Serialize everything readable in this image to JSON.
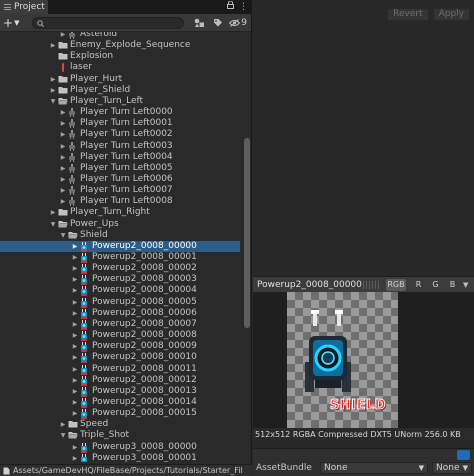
{
  "project_panel": {
    "tab_label": "Project",
    "search": {
      "value": "",
      "placeholder": ""
    },
    "hidden_count": "9",
    "tree": [
      {
        "label": "Asteroid",
        "type": "frame",
        "depth": 4,
        "arrow": "collapsed"
      },
      {
        "label": "Enemy_Explode_Sequence",
        "type": "folder",
        "depth": 3,
        "arrow": "collapsed"
      },
      {
        "label": "Explosion",
        "type": "folder",
        "depth": 3,
        "arrow": "none"
      },
      {
        "label": "laser",
        "type": "laser",
        "depth": 3,
        "arrow": "none"
      },
      {
        "label": "Player_Hurt",
        "type": "folder",
        "depth": 3,
        "arrow": "collapsed"
      },
      {
        "label": "Player_Shield",
        "type": "folder",
        "depth": 3,
        "arrow": "collapsed"
      },
      {
        "label": "Player_Turn_Left",
        "type": "folder",
        "depth": 3,
        "arrow": "expanded"
      },
      {
        "label": "Player Turn Left0000",
        "type": "frame",
        "depth": 4,
        "arrow": "collapsed"
      },
      {
        "label": "Player Turn Left0001",
        "type": "frame",
        "depth": 4,
        "arrow": "collapsed"
      },
      {
        "label": "Player Turn Left0002",
        "type": "frame",
        "depth": 4,
        "arrow": "collapsed"
      },
      {
        "label": "Player Turn Left0003",
        "type": "frame",
        "depth": 4,
        "arrow": "collapsed"
      },
      {
        "label": "Player Turn Left0004",
        "type": "frame",
        "depth": 4,
        "arrow": "collapsed"
      },
      {
        "label": "Player Turn Left0005",
        "type": "frame",
        "depth": 4,
        "arrow": "collapsed"
      },
      {
        "label": "Player Turn Left0006",
        "type": "frame",
        "depth": 4,
        "arrow": "collapsed"
      },
      {
        "label": "Player Turn Left0007",
        "type": "frame",
        "depth": 4,
        "arrow": "collapsed"
      },
      {
        "label": "Player Turn Left0008",
        "type": "frame",
        "depth": 4,
        "arrow": "collapsed"
      },
      {
        "label": "Player_Turn_Right",
        "type": "folder",
        "depth": 3,
        "arrow": "collapsed"
      },
      {
        "label": "Power_Ups",
        "type": "folder",
        "depth": 3,
        "arrow": "expanded"
      },
      {
        "label": "Shield",
        "type": "folder",
        "depth": 4,
        "arrow": "expanded"
      },
      {
        "label": "Powerup2_0008_00000",
        "type": "powerup",
        "depth": 5,
        "arrow": "collapsed",
        "selected": true
      },
      {
        "label": "Powerup2_0008_00001",
        "type": "powerup",
        "depth": 5,
        "arrow": "collapsed"
      },
      {
        "label": "Powerup2_0008_00002",
        "type": "powerup",
        "depth": 5,
        "arrow": "collapsed"
      },
      {
        "label": "Powerup2_0008_00003",
        "type": "powerup",
        "depth": 5,
        "arrow": "collapsed"
      },
      {
        "label": "Powerup2_0008_00004",
        "type": "powerup",
        "depth": 5,
        "arrow": "collapsed"
      },
      {
        "label": "Powerup2_0008_00005",
        "type": "powerup",
        "depth": 5,
        "arrow": "collapsed"
      },
      {
        "label": "Powerup2_0008_00006",
        "type": "powerup",
        "depth": 5,
        "arrow": "collapsed"
      },
      {
        "label": "Powerup2_0008_00007",
        "type": "powerup",
        "depth": 5,
        "arrow": "collapsed"
      },
      {
        "label": "Powerup2_0008_00008",
        "type": "powerup",
        "depth": 5,
        "arrow": "collapsed"
      },
      {
        "label": "Powerup2_0008_00009",
        "type": "powerup",
        "depth": 5,
        "arrow": "collapsed"
      },
      {
        "label": "Powerup2_0008_00010",
        "type": "powerup",
        "depth": 5,
        "arrow": "collapsed"
      },
      {
        "label": "Powerup2_0008_00011",
        "type": "powerup",
        "depth": 5,
        "arrow": "collapsed"
      },
      {
        "label": "Powerup2_0008_00012",
        "type": "powerup",
        "depth": 5,
        "arrow": "collapsed"
      },
      {
        "label": "Powerup2_0008_00013",
        "type": "powerup",
        "depth": 5,
        "arrow": "collapsed"
      },
      {
        "label": "Powerup2_0008_00014",
        "type": "powerup",
        "depth": 5,
        "arrow": "collapsed"
      },
      {
        "label": "Powerup2_0008_00015",
        "type": "powerup",
        "depth": 5,
        "arrow": "collapsed"
      },
      {
        "label": "Speed",
        "type": "folder",
        "depth": 4,
        "arrow": "collapsed"
      },
      {
        "label": "Triple_Shot",
        "type": "folder",
        "depth": 4,
        "arrow": "expanded"
      },
      {
        "label": "Powerup3_0008_00000",
        "type": "powerup",
        "depth": 5,
        "arrow": "collapsed"
      },
      {
        "label": "Powerup3_0008_00001",
        "type": "powerup",
        "depth": 5,
        "arrow": "collapsed"
      }
    ],
    "path": "Assets/GameDevHQ/FileBase/Projects/Tutorials/Starter_Fil"
  },
  "inspector": {
    "revert_label": "Revert",
    "apply_label": "Apply",
    "preview": {
      "title": "Powerup2_0008_00000",
      "channels": {
        "rgb": "RGB",
        "r": "R",
        "g": "G",
        "b": "B"
      },
      "sprite_text": "SHIELD",
      "info": "512x512  RGBA Compressed DXT5 UNorm  256.0 KB"
    },
    "asset_bundle": {
      "label": "AssetBundle",
      "name_value": "None",
      "variant_value": "None"
    }
  },
  "colors": {
    "panel_bg": "#2a2a2a",
    "selection": "#2c5d87",
    "folder": "#c2c2c2",
    "laser": "#e04040",
    "shield_text": "#ff2020"
  }
}
